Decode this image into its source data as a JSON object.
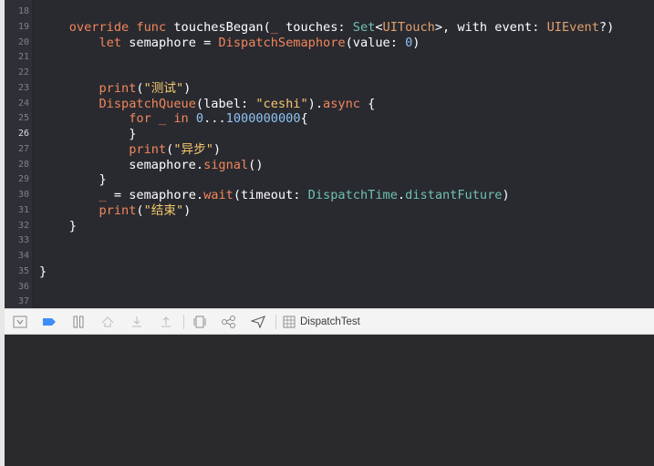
{
  "editor": {
    "lines": [
      {
        "num": "18",
        "current": false,
        "tokens": []
      },
      {
        "num": "19",
        "current": false,
        "tokens": [
          {
            "t": "    ",
            "c": ""
          },
          {
            "t": "override",
            "c": "kw"
          },
          {
            "t": " ",
            "c": ""
          },
          {
            "t": "func",
            "c": "kw"
          },
          {
            "t": " touchesBegan(",
            "c": ""
          },
          {
            "t": "_",
            "c": "kw"
          },
          {
            "t": " touches: ",
            "c": ""
          },
          {
            "t": "Set",
            "c": "ty"
          },
          {
            "t": "<",
            "c": ""
          },
          {
            "t": "UITouch",
            "c": "tyu"
          },
          {
            "t": ">, with event: ",
            "c": ""
          },
          {
            "t": "UIEvent",
            "c": "tyu"
          },
          {
            "t": "?)",
            "c": ""
          }
        ]
      },
      {
        "num": "20",
        "current": false,
        "tokens": [
          {
            "t": "        ",
            "c": ""
          },
          {
            "t": "let",
            "c": "kw"
          },
          {
            "t": " semaphore = ",
            "c": ""
          },
          {
            "t": "DispatchSemaphore",
            "c": "sig"
          },
          {
            "t": "(value: ",
            "c": ""
          },
          {
            "t": "0",
            "c": "nm"
          },
          {
            "t": ")",
            "c": ""
          }
        ]
      },
      {
        "num": "21",
        "current": false,
        "tokens": []
      },
      {
        "num": "22",
        "current": false,
        "tokens": []
      },
      {
        "num": "23",
        "current": false,
        "tokens": [
          {
            "t": "        ",
            "c": ""
          },
          {
            "t": "print",
            "c": "pk"
          },
          {
            "t": "(",
            "c": ""
          },
          {
            "t": "\"测试\"",
            "c": "st"
          },
          {
            "t": ")",
            "c": ""
          }
        ]
      },
      {
        "num": "24",
        "current": false,
        "tokens": [
          {
            "t": "        ",
            "c": ""
          },
          {
            "t": "DispatchQueue",
            "c": "sig"
          },
          {
            "t": "(label: ",
            "c": ""
          },
          {
            "t": "\"ceshi\"",
            "c": "st"
          },
          {
            "t": ").",
            "c": ""
          },
          {
            "t": "async",
            "c": "sig"
          },
          {
            "t": " {",
            "c": ""
          }
        ]
      },
      {
        "num": "25",
        "current": false,
        "tokens": [
          {
            "t": "            ",
            "c": ""
          },
          {
            "t": "for",
            "c": "kw"
          },
          {
            "t": " ",
            "c": ""
          },
          {
            "t": "_",
            "c": "kw"
          },
          {
            "t": " ",
            "c": ""
          },
          {
            "t": "in",
            "c": "kw"
          },
          {
            "t": " ",
            "c": ""
          },
          {
            "t": "0",
            "c": "nm"
          },
          {
            "t": "...",
            "c": ""
          },
          {
            "t": "1000000000",
            "c": "nm"
          },
          {
            "t": "{",
            "c": ""
          }
        ]
      },
      {
        "num": "26",
        "current": true,
        "tokens": [
          {
            "t": "            }",
            "c": ""
          }
        ]
      },
      {
        "num": "27",
        "current": false,
        "tokens": [
          {
            "t": "            ",
            "c": ""
          },
          {
            "t": "print",
            "c": "pk"
          },
          {
            "t": "(",
            "c": ""
          },
          {
            "t": "\"异步\"",
            "c": "st"
          },
          {
            "t": ")",
            "c": ""
          }
        ]
      },
      {
        "num": "28",
        "current": false,
        "tokens": [
          {
            "t": "            semaphore.",
            "c": ""
          },
          {
            "t": "signal",
            "c": "sig"
          },
          {
            "t": "()",
            "c": ""
          }
        ]
      },
      {
        "num": "29",
        "current": false,
        "tokens": [
          {
            "t": "        }",
            "c": ""
          }
        ]
      },
      {
        "num": "30",
        "current": false,
        "tokens": [
          {
            "t": "        ",
            "c": ""
          },
          {
            "t": "_",
            "c": "kw"
          },
          {
            "t": " = semaphore.",
            "c": ""
          },
          {
            "t": "wait",
            "c": "sig"
          },
          {
            "t": "(timeout: ",
            "c": ""
          },
          {
            "t": "DispatchTime",
            "c": "ty"
          },
          {
            "t": ".",
            "c": ""
          },
          {
            "t": "distantFuture",
            "c": "ty"
          },
          {
            "t": ")",
            "c": ""
          }
        ]
      },
      {
        "num": "31",
        "current": false,
        "tokens": [
          {
            "t": "        ",
            "c": ""
          },
          {
            "t": "print",
            "c": "pk"
          },
          {
            "t": "(",
            "c": ""
          },
          {
            "t": "\"结束\"",
            "c": "st"
          },
          {
            "t": ")",
            "c": ""
          }
        ]
      },
      {
        "num": "32",
        "current": false,
        "tokens": [
          {
            "t": "    }",
            "c": ""
          }
        ]
      },
      {
        "num": "33",
        "current": false,
        "tokens": []
      },
      {
        "num": "34",
        "current": false,
        "tokens": []
      },
      {
        "num": "35",
        "current": false,
        "tokens": [
          {
            "t": "}",
            "c": ""
          }
        ]
      },
      {
        "num": "36",
        "current": false,
        "tokens": []
      },
      {
        "num": "37",
        "current": false,
        "tokens": []
      }
    ]
  },
  "debug_bar": {
    "target_label": "DispatchTest",
    "buttons": [
      {
        "name": "hide-debug-area-icon"
      },
      {
        "name": "breakpoints-toggle-icon"
      },
      {
        "name": "pause-icon"
      },
      {
        "name": "step-over-icon"
      },
      {
        "name": "step-into-icon"
      },
      {
        "name": "step-out-icon"
      },
      {
        "name": "view-hierarchy-icon"
      },
      {
        "name": "memory-graph-icon"
      },
      {
        "name": "simulate-location-icon"
      }
    ]
  },
  "colors": {
    "editor_bg": "#292a30",
    "keyword": "#f2865a",
    "string": "#f5c86e",
    "number": "#8ec2f0",
    "type": "#70c0b1",
    "accent_blue": "#3e8ef7"
  }
}
